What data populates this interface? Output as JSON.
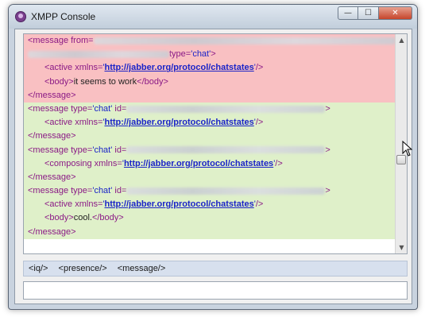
{
  "window": {
    "title": "XMPP Console",
    "controls": {
      "minimize": "—",
      "maximize": "☐",
      "close": "✕"
    }
  },
  "log": {
    "lines": [
      {
        "dir": "in",
        "indent": false,
        "tag": "<message from=",
        "attr": "",
        "url": "",
        "rest": ""
      },
      {
        "dir": "in",
        "indent": false,
        "tag": "",
        "attr": "type='chat'",
        "url": "",
        "rest": ">"
      },
      {
        "dir": "in",
        "indent": true,
        "tag": "<active xmlns=",
        "attr": "'",
        "url": "http://jabber.org/protocol/chatstates",
        "rest": "'/>"
      },
      {
        "dir": "in",
        "indent": true,
        "tag": "<body>",
        "attr": "",
        "url": "",
        "rest": "it seems to work",
        "close": "</body>"
      },
      {
        "dir": "in",
        "indent": false,
        "tag": "</message>",
        "attr": "",
        "url": "",
        "rest": ""
      },
      {
        "dir": "out",
        "indent": false,
        "tag": "<message type=",
        "attr": "'chat'",
        "tag2": " id=",
        "url": "",
        "rest": ">"
      },
      {
        "dir": "out",
        "indent": true,
        "tag": "<active xmlns=",
        "attr": "'",
        "url": "http://jabber.org/protocol/chatstates",
        "rest": "'/>"
      },
      {
        "dir": "out",
        "indent": false,
        "tag": "</message>",
        "attr": "",
        "url": "",
        "rest": ""
      },
      {
        "dir": "out",
        "indent": false,
        "tag": "<message type=",
        "attr": "'chat'",
        "tag2": " id=",
        "url": "",
        "rest": ">"
      },
      {
        "dir": "out",
        "indent": true,
        "tag": "<composing xmlns=",
        "attr": "'",
        "url": "http://jabber.org/protocol/chatstates",
        "rest": "'/>"
      },
      {
        "dir": "out",
        "indent": false,
        "tag": "</message>",
        "attr": "",
        "url": "",
        "rest": ""
      },
      {
        "dir": "out",
        "indent": false,
        "tag": "<message type=",
        "attr": "'chat'",
        "tag2": " id=",
        "url": "",
        "rest": ">"
      },
      {
        "dir": "out",
        "indent": true,
        "tag": "<active xmlns=",
        "attr": "'",
        "url": "http://jabber.org/protocol/chatstates",
        "rest": "'/>"
      },
      {
        "dir": "out",
        "indent": true,
        "tag": "<body>",
        "attr": "",
        "url": "",
        "rest": "cool.",
        "close": "</body>"
      },
      {
        "dir": "out",
        "indent": false,
        "tag": "</message>",
        "attr": "",
        "url": "",
        "rest": ""
      }
    ]
  },
  "shortcuts": [
    "<iq/>",
    "<presence/>",
    "<message/>"
  ],
  "input": {
    "value": ""
  },
  "colors": {
    "incoming_bg": "#f9c0c2",
    "outgoing_bg": "#dff0c9",
    "tag": "#8b1a86",
    "link": "#1b24c8"
  }
}
